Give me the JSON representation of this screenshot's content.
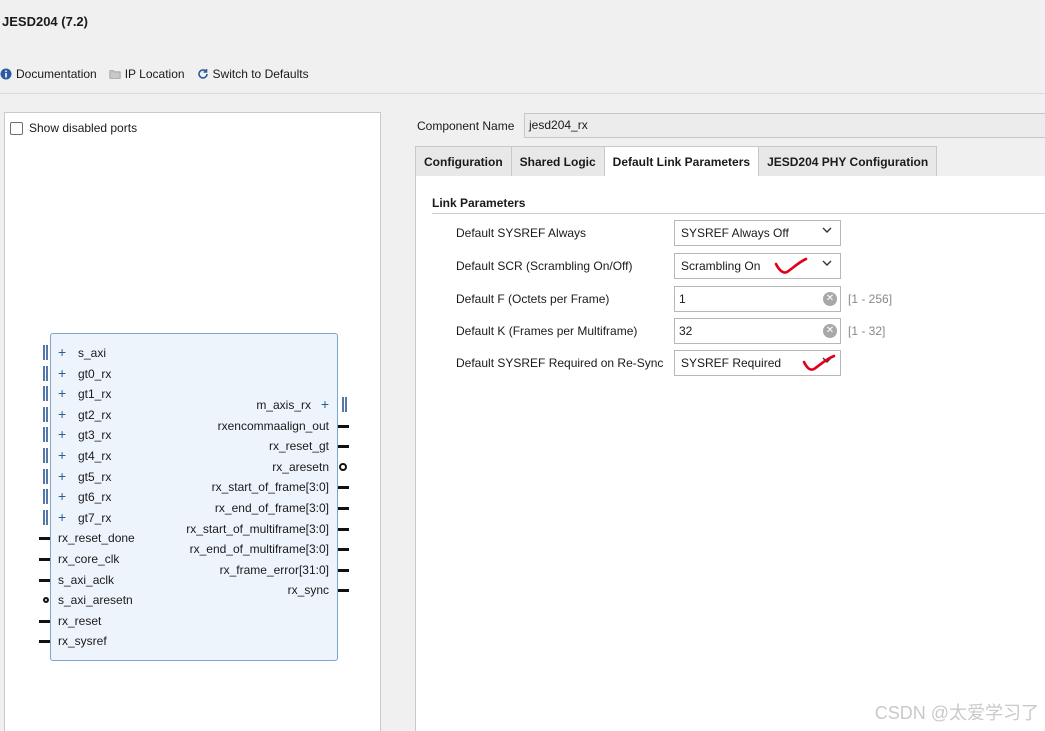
{
  "window": {
    "title": "JESD204 (7.2)"
  },
  "toolbar": {
    "documentation": "Documentation",
    "ip_location": "IP Location",
    "switch_defaults": "Switch to Defaults"
  },
  "left_panel": {
    "show_disabled": "Show disabled ports",
    "ports_left": [
      "s_axi",
      "gt0_rx",
      "gt1_rx",
      "gt2_rx",
      "gt3_rx",
      "gt4_rx",
      "gt5_rx",
      "gt6_rx",
      "gt7_rx",
      "rx_reset_done",
      "rx_core_clk",
      "s_axi_aclk",
      "s_axi_aresetn",
      "rx_reset",
      "rx_sysref"
    ],
    "ports_right": [
      "m_axis_rx",
      "rxencommaalign_out",
      "rx_reset_gt",
      "rx_aresetn",
      "rx_start_of_frame[3:0]",
      "rx_end_of_frame[3:0]",
      "rx_start_of_multiframe[3:0]",
      "rx_end_of_multiframe[3:0]",
      "rx_frame_error[31:0]",
      "rx_sync"
    ]
  },
  "component": {
    "label": "Component Name",
    "value": "jesd204_rx"
  },
  "tabs": [
    "Configuration",
    "Shared Logic",
    "Default Link Parameters",
    "JESD204 PHY Configuration"
  ],
  "link_params": {
    "section_title": "Link Parameters",
    "sysref_always": {
      "label": "Default SYSREF Always",
      "value": "SYSREF Always Off"
    },
    "scr": {
      "label": "Default SCR (Scrambling On/Off)",
      "value": "Scrambling On"
    },
    "f": {
      "label": "Default F (Octets per Frame)",
      "value": "1",
      "range": "[1 - 256]"
    },
    "k": {
      "label": "Default K (Frames per Multiframe)",
      "value": "32",
      "range": "[1 - 32]"
    },
    "sysref_resync": {
      "label": "Default SYSREF Required on Re-Sync",
      "value": "SYSREF Required"
    }
  },
  "watermark": "CSDN @太爱学习了",
  "colors": {
    "annotation": "#e0001b",
    "block_fill": "#eef4fb",
    "block_border": "#7aa6cf"
  }
}
